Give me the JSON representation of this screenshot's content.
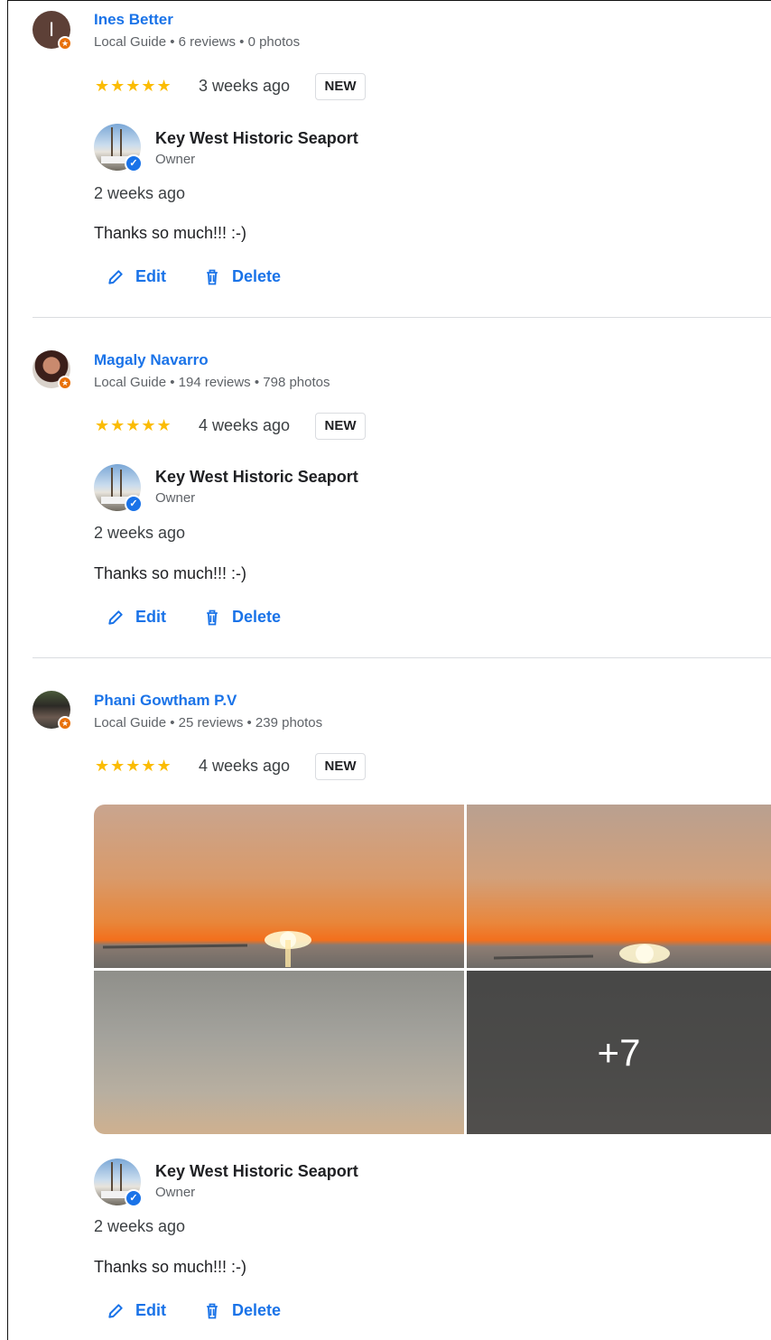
{
  "reviews": [
    {
      "author": "Ines Better",
      "author_initial": "I",
      "meta": "Local Guide • 6 reviews • 0 photos",
      "stars": "★★★★★",
      "time": "3 weeks ago",
      "tag": "NEW",
      "reply": {
        "owner": "Key West Historic Seaport",
        "role": "Owner",
        "time": "2 weeks ago",
        "text": "Thanks so much!!! :-)"
      },
      "actions": {
        "edit": "Edit",
        "delete": "Delete"
      }
    },
    {
      "author": "Magaly Navarro",
      "meta": "Local Guide • 194 reviews • 798 photos",
      "stars": "★★★★★",
      "time": "4 weeks ago",
      "tag": "NEW",
      "reply": {
        "owner": "Key West Historic Seaport",
        "role": "Owner",
        "time": "2 weeks ago",
        "text": "Thanks so much!!! :-)"
      },
      "actions": {
        "edit": "Edit",
        "delete": "Delete"
      }
    },
    {
      "author": "Phani Gowtham P.V",
      "meta": "Local Guide • 25 reviews • 239 photos",
      "stars": "★★★★★",
      "time": "4 weeks ago",
      "tag": "NEW",
      "photos_more": "+7",
      "reply": {
        "owner": "Key West Historic Seaport",
        "role": "Owner",
        "time": "2 weeks ago",
        "text": "Thanks so much!!! :-)"
      },
      "actions": {
        "edit": "Edit",
        "delete": "Delete"
      }
    }
  ],
  "colors": {
    "link": "#1a73e8",
    "star": "#fbbc04",
    "local_guide_badge": "#e8710a"
  },
  "icons": {
    "edit": "pencil-icon",
    "delete": "trash-icon",
    "verified": "verified-check-icon",
    "local_guide": "local-guide-badge-icon"
  }
}
